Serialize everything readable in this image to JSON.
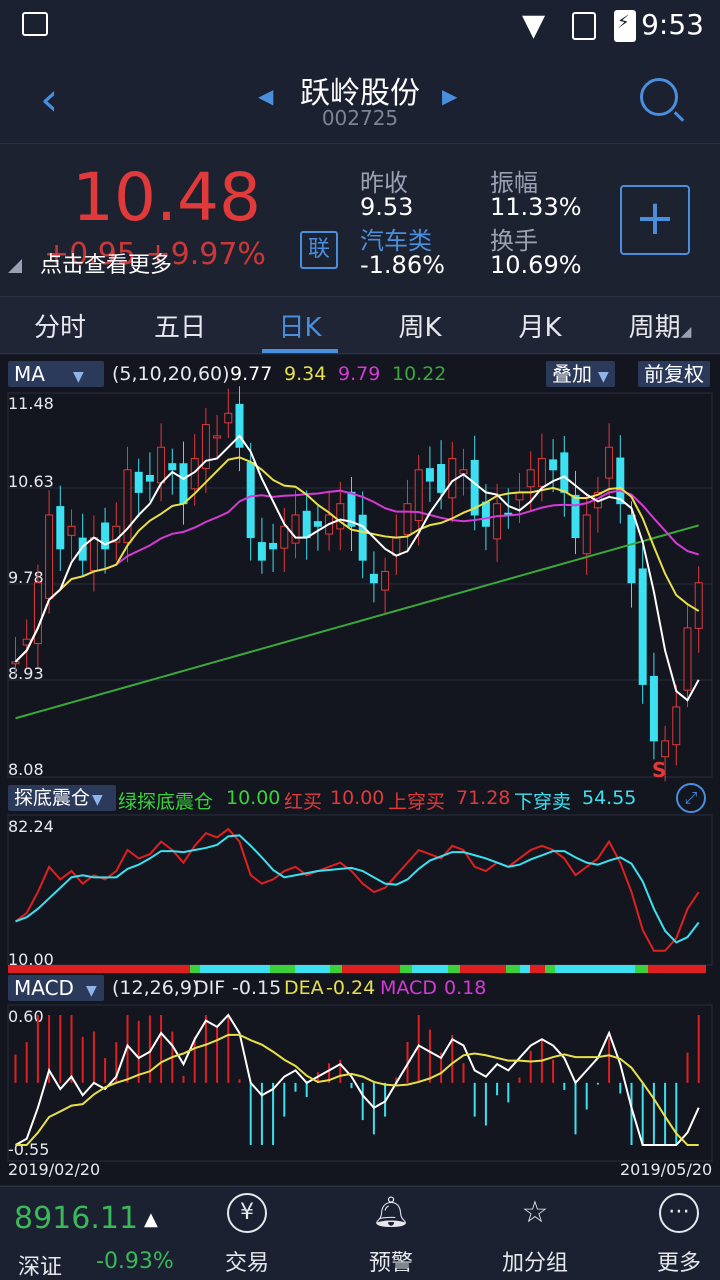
{
  "status": {
    "time": "9:53"
  },
  "header": {
    "name": "跃岭股份",
    "code": "002725"
  },
  "quote": {
    "price": "10.48",
    "change": "+0.95  +9.97%",
    "hint": "点击查看更多",
    "lian": "联",
    "prev_close_label": "昨收",
    "prev_close": "9.53",
    "sector_label": "汽车类",
    "sector_change": "-1.86%",
    "amplitude_label": "振幅",
    "amplitude": "11.33%",
    "turnover_label": "换手",
    "turnover": "10.69%",
    "add_label": "+"
  },
  "tabs": [
    "分时",
    "五日",
    "日K",
    "周K",
    "月K",
    "周期"
  ],
  "ma": {
    "btn": "MA",
    "params": "(5,10,20,60)",
    "v5": "9.77",
    "v10": "9.34",
    "v20": "9.79",
    "v60": "10.22",
    "overlay": "叠加",
    "adjust": "前复权",
    "colors": {
      "ma5": "#ffffff",
      "ma10": "#e8e04a",
      "ma20": "#d63ad6",
      "ma60": "#3aa83a"
    }
  },
  "kline": {
    "yticks": [
      "11.48",
      "10.63",
      "9.78",
      "8.93",
      "8.08"
    ],
    "sell_mark": "S"
  },
  "indicator": {
    "btn": "探底震仓",
    "green_label": "绿探底震仓",
    "green_val": "10.00",
    "red_label": "红买",
    "red_val": "10.00",
    "up_label": "上穿买",
    "up_val": "71.28",
    "down_label": "下穿卖",
    "down_val": "54.55",
    "ymax": "82.24",
    "ymin": "10.00"
  },
  "macd": {
    "btn": "MACD",
    "params": "(12,26,9)",
    "dif_label": "DIF",
    "dif": "-0.15",
    "dea_label": "DEA",
    "dea": "-0.24",
    "macd_label": "MACD",
    "macd": "0.18",
    "ymax": "0.60",
    "ymin": "-0.55",
    "date_start": "2019/02/20",
    "date_end": "2019/05/20"
  },
  "footer": {
    "index_value": "8916.11",
    "index_name": "深证",
    "index_pct": "-0.93%",
    "nav": [
      "交易",
      "预警",
      "加分组",
      "更多"
    ]
  }
}
